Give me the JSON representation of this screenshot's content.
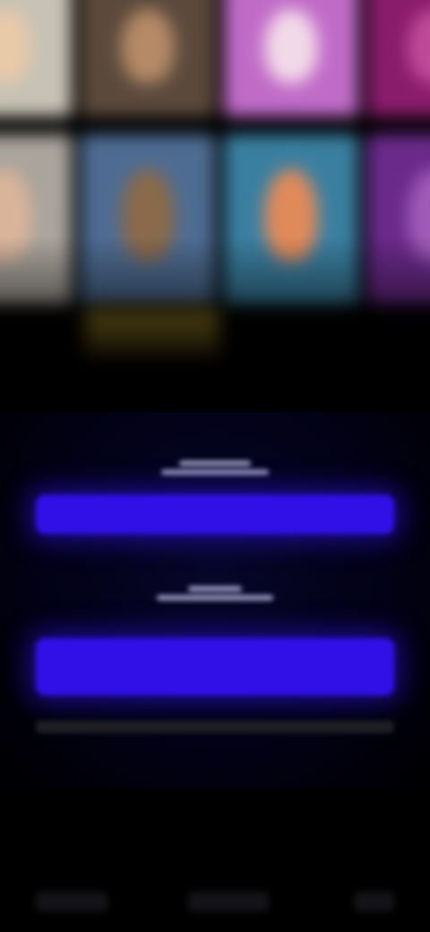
{
  "colors": {
    "background": "#000000",
    "accent": "#3110e8",
    "panel": "#07062a"
  },
  "posters": [
    {
      "id": "poster-1",
      "bg": "#c7c2b5",
      "face": "#e8c9a8"
    },
    {
      "id": "poster-2",
      "bg": "#5b4a3c",
      "face": "#b58a66"
    },
    {
      "id": "poster-3",
      "bg": "#c06cc7",
      "face": "#f2d9e8"
    },
    {
      "id": "poster-4",
      "bg": "#8a1c6c",
      "face": "#c04a9a"
    },
    {
      "id": "poster-5",
      "bg": "#a9a49c",
      "face": "#d9b49a"
    },
    {
      "id": "poster-6",
      "bg": "#4e6c92",
      "face": "#8a6a4a"
    },
    {
      "id": "poster-7",
      "bg": "#3a7fa0",
      "face": "#e08a5a"
    },
    {
      "id": "poster-8",
      "bg": "#6a2a8a",
      "face": "#a05ab8"
    }
  ],
  "panel": {
    "heading_1": "",
    "primary_button": "",
    "heading_2": "",
    "secondary_button": "",
    "terms": ""
  },
  "bottom_nav": {
    "left": "",
    "center": "",
    "right": ""
  }
}
